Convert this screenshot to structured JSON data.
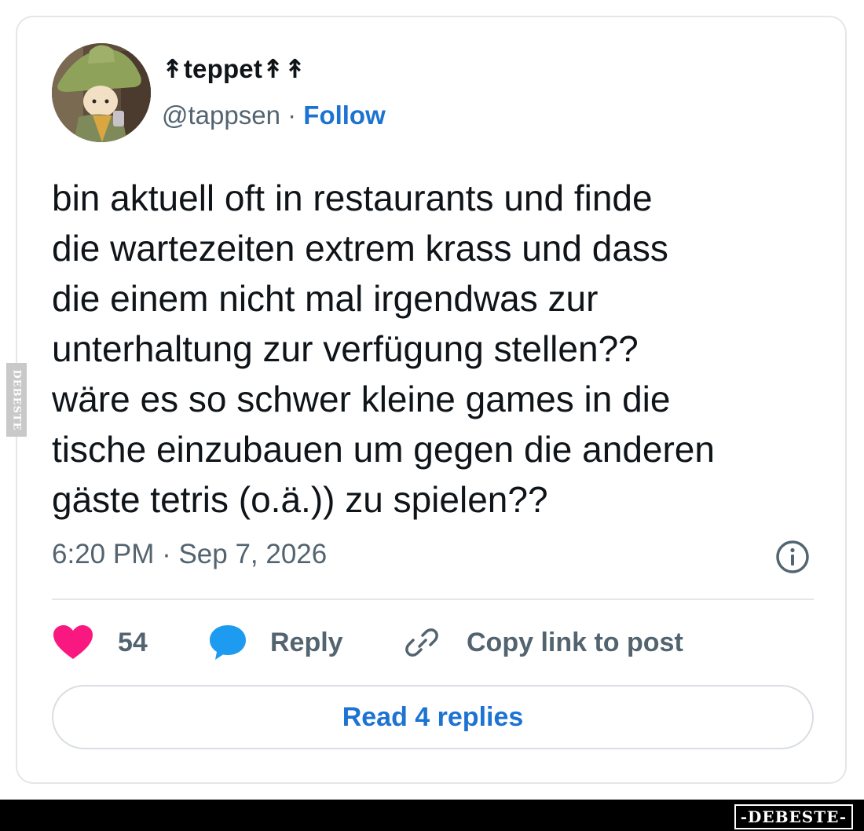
{
  "author": {
    "display_name": "↟teppet↟↟",
    "handle": "@tappsen",
    "separator": "·",
    "follow_label": "Follow"
  },
  "post": {
    "text_lines": [
      "bin aktuell oft in restaurants und finde",
      "die wartezeiten extrem krass und dass",
      "die einem nicht mal irgendwas zur",
      "unterhaltung zur verfügung stellen??",
      "wäre es so schwer kleine games in die",
      "tische einzubauen um gegen die anderen",
      "gäste tetris (o.ä.)) zu spielen??"
    ],
    "timestamp": "6:20 PM · Sep 7, 2026"
  },
  "actions": {
    "like_count": "54",
    "reply_label": "Reply",
    "copy_link_label": "Copy link to post"
  },
  "read_replies_label": "Read 4 replies",
  "watermarks": {
    "side_text": "DEBESTE",
    "logo_text": "-DEBESTE-"
  },
  "colors": {
    "heart": "#f91880",
    "reply_bubble": "#1d9bf0",
    "link_blue": "#1d73d2",
    "muted_text": "#536471"
  },
  "icons": [
    "avatar-image",
    "info-icon",
    "heart-icon",
    "reply-bubble-icon",
    "link-icon"
  ]
}
